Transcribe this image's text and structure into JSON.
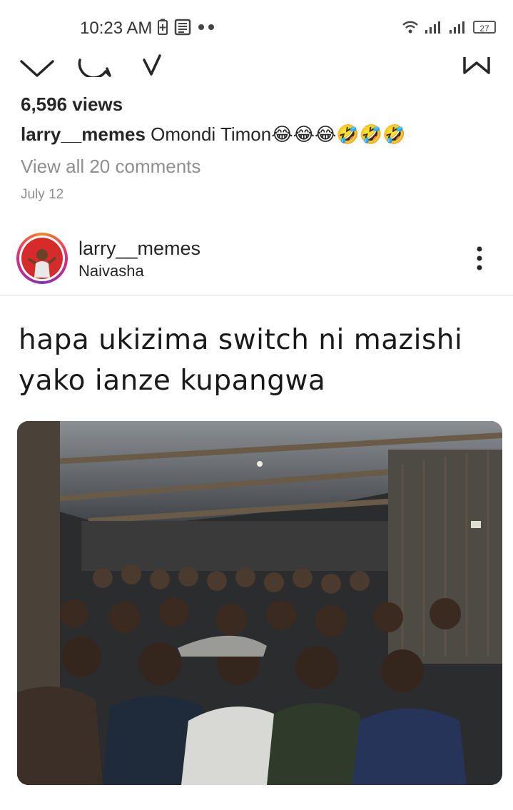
{
  "status_bar": {
    "time": "10:23 AM",
    "battery_level": "27"
  },
  "post_prev": {
    "views": "6,596 views",
    "caption_user": "larry__memes",
    "caption_text": "Omondi Timon😂😂😂🤣🤣🤣",
    "view_comments": "View all 20 comments",
    "date": "July 12"
  },
  "post": {
    "username": "larry__memes",
    "location": "Naivasha",
    "meme_text": "hapa ukizima switch ni mazishi yako ianze kupangwa"
  },
  "colors": {
    "text": "#262626",
    "secondary": "#8e8e8e",
    "divider": "#dbdbdb"
  }
}
